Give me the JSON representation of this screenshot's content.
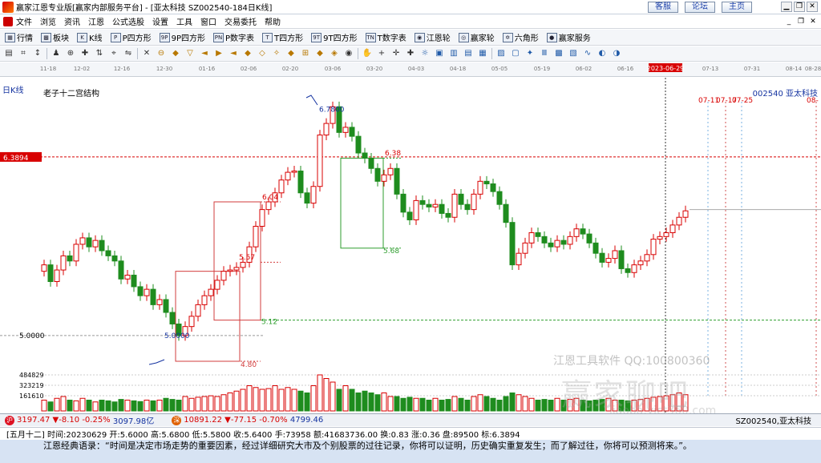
{
  "window": {
    "title": "赢家江恩专业版[赢家内部服务平台] - [亚太科技  SZ002540-184日K线]",
    "links": [
      "客服",
      "论坛",
      "主页"
    ]
  },
  "menu": [
    "文件",
    "浏览",
    "资讯",
    "江恩",
    "公式选股",
    "设置",
    "工具",
    "窗口",
    "交易委托",
    "帮助"
  ],
  "toolbar": [
    {
      "icon": "grid-icon",
      "label": "行情",
      "glyph": "▦"
    },
    {
      "icon": "blocks-icon",
      "label": "板块",
      "glyph": "▩"
    },
    {
      "icon": "kline-icon",
      "label": "K线",
      "glyph": "K"
    },
    {
      "icon": "p-square-icon",
      "label": "P四方形",
      "glyph": "P"
    },
    {
      "icon": "9p-square-icon",
      "label": "9P四方形",
      "glyph": "9P"
    },
    {
      "icon": "p-number-icon",
      "label": "P数字表",
      "glyph": "PN"
    },
    {
      "icon": "t-square-icon",
      "label": "T四方形",
      "glyph": "T"
    },
    {
      "icon": "9t-square-icon",
      "label": "9T四方形",
      "glyph": "9T"
    },
    {
      "icon": "t-number-icon",
      "label": "T数字表",
      "glyph": "TN"
    },
    {
      "icon": "gann-wheel-icon",
      "label": "江恩轮",
      "glyph": "◉"
    },
    {
      "icon": "winner-wheel-icon",
      "label": "赢家轮",
      "glyph": "◎"
    },
    {
      "icon": "hexagon-icon",
      "label": "六角形",
      "glyph": "✡"
    },
    {
      "icon": "service-icon",
      "label": "赢家服务",
      "glyph": "●"
    }
  ],
  "chart": {
    "period": "日K线",
    "indicator": "老子十二宫结构",
    "stock": "002540  亚太科技",
    "date_ticks": [
      "11-18",
      "12-02",
      "12-16",
      "12-30",
      "01-16",
      "02-06",
      "02-20",
      "03-06",
      "03-20",
      "04-03",
      "04-18",
      "05-05",
      "05-19",
      "06-02",
      "06-16",
      "2023-06-29",
      "07-13",
      "07-31",
      "08-14",
      "08-28"
    ],
    "future_dates": [
      "07-11",
      "07-17",
      "07-25",
      "08-"
    ],
    "price_tag": "6.3894",
    "annotations": [
      "6.7800",
      "6.38",
      "6.04",
      "5.57",
      "5.68",
      "5.12",
      "5.0000",
      "4.80",
      "5.0000"
    ],
    "vol_ticks": [
      "484829",
      "323219",
      "161610"
    ],
    "accent_red": "#d80000",
    "accent_green": "#1e8c1e",
    "box_red": "#d23c3c",
    "box_green": "#2e9e2e"
  },
  "chart_data": {
    "type": "candlestick",
    "title": "老子十二宫结构",
    "ylim": [
      4.8,
      6.85
    ],
    "annotations": {
      "high": 6.78,
      "low": 5.0,
      "levels": [
        6.3894,
        6.38,
        6.04,
        5.57,
        5.68,
        5.12,
        4.8
      ]
    },
    "series": [
      {
        "name": "price",
        "values": [
          5.55,
          5.42,
          5.51,
          5.62,
          5.58,
          5.71,
          5.76,
          5.69,
          5.74,
          5.66,
          5.62,
          5.58,
          5.44,
          5.47,
          5.38,
          5.31,
          5.36,
          5.24,
          5.28,
          5.18,
          5.09,
          5.0,
          5.07,
          5.15,
          5.24,
          5.31,
          5.36,
          5.43,
          5.5,
          5.51,
          5.53,
          5.57,
          5.69,
          5.85,
          5.98,
          6.04,
          6.11,
          6.21,
          6.27,
          6.28,
          6.11,
          6.03,
          6.16,
          6.56,
          6.65,
          6.78,
          6.58,
          6.62,
          6.55,
          6.42,
          6.38,
          6.3,
          6.2,
          6.25,
          6.3,
          6.1,
          5.96,
          5.9,
          6.05,
          6.02,
          6.0,
          6.02,
          5.95,
          5.92,
          6.1,
          6.02,
          5.98,
          6.1,
          6.2,
          6.18,
          6.12,
          6.02,
          5.88,
          5.55,
          5.64,
          5.72,
          5.8,
          5.77,
          5.72,
          5.69,
          5.74,
          5.71,
          5.77,
          5.83,
          5.79,
          5.72,
          5.64,
          5.57,
          5.6,
          5.66,
          5.52,
          5.49,
          5.55,
          5.58,
          5.63,
          5.75,
          5.77,
          5.8,
          5.86,
          5.92,
          5.97
        ]
      }
    ],
    "volume": [
      0.3,
      0.25,
      0.35,
      0.4,
      0.3,
      0.28,
      0.35,
      0.3,
      0.25,
      0.3,
      0.28,
      0.25,
      0.32,
      0.3,
      0.28,
      0.26,
      0.3,
      0.28,
      0.3,
      0.35,
      0.32,
      0.3,
      0.4,
      0.35,
      0.38,
      0.4,
      0.42,
      0.4,
      0.45,
      0.5,
      0.55,
      0.6,
      0.7,
      0.65,
      0.6,
      0.62,
      0.7,
      0.6,
      0.65,
      0.6,
      0.55,
      0.5,
      0.7,
      1.0,
      0.9,
      0.8,
      0.6,
      0.7,
      0.6,
      0.5,
      0.55,
      0.5,
      0.45,
      0.5,
      0.4,
      0.4,
      0.35,
      0.38,
      0.35,
      0.35,
      0.3,
      0.35,
      0.3,
      0.32,
      0.4,
      0.35,
      0.3,
      0.4,
      0.45,
      0.4,
      0.35,
      0.3,
      0.4,
      0.5,
      0.45,
      0.4,
      0.35,
      0.3,
      0.32,
      0.3,
      0.35,
      0.3,
      0.32,
      0.35,
      0.3,
      0.28,
      0.3,
      0.32,
      0.35,
      0.3,
      0.3,
      0.28,
      0.3,
      0.32,
      0.35,
      0.38,
      0.4,
      0.42,
      0.45,
      0.5,
      0.45
    ],
    "volume_ticks": [
      161610,
      323219,
      484829
    ]
  },
  "status": {
    "sh_index": "3197.47",
    "sh_change": "▼-8.10",
    "sh_pct": "-0.25%",
    "sh_amount": "3097.98亿",
    "sz_index": "10891.22",
    "sz_change": "▼-77.15",
    "sz_pct": "-0.70%",
    "sz_amount": "4799.46",
    "stock_code": "SZ002540,亚太科技"
  },
  "status2": {
    "text": "[五月十二] 时间:20230629 开:5.6000 高:5.6800 低:5.5800 收:5.6400 手:73958 额:41683736.00 换:0.83 涨:0.36 盘:89500 标:6.3894"
  },
  "quote": "江恩经典语录：“时间是决定市场走势的重要因素，经过详细研究大市及个别股票的过往记录，你将可以证明，历史确实重复发生；而了解过往，你将可以预测将来。”。",
  "watermark": {
    "line1": "江恩工具软件  QQ:100800360",
    "line2": "赢家聊吧",
    "line3": "liaoba.yict360.com"
  }
}
